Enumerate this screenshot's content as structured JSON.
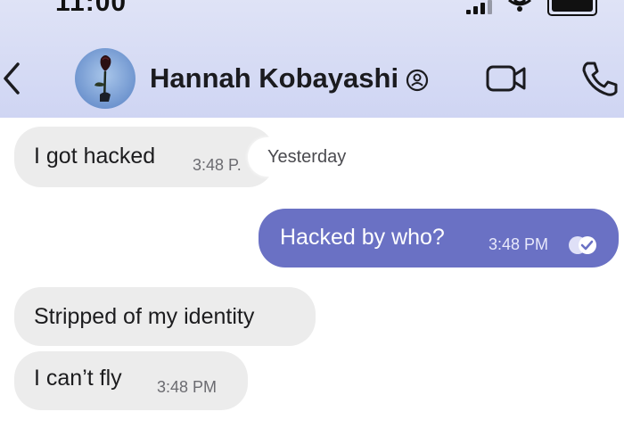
{
  "status_bar": {
    "time": "11:00"
  },
  "header": {
    "contact_name": "Hannah Kobayashi",
    "icons": [
      "back-icon",
      "avatar-rose-image",
      "verified-icon",
      "video-call-icon",
      "phone-call-icon"
    ]
  },
  "date_separator": "Yesterday",
  "messages": [
    {
      "direction": "incoming",
      "text": "I got hacked",
      "time": "3:48 P."
    },
    {
      "direction": "outgoing",
      "text": "Hacked by who?",
      "time": "3:48 PM",
      "status": "read"
    },
    {
      "direction": "incoming",
      "text": "Stripped of my identity",
      "time": ""
    },
    {
      "direction": "incoming",
      "text": "I can’t fly",
      "time": "3:48 PM"
    }
  ],
  "colors": {
    "header_bg": "#d4d9f4",
    "outgoing_bubble": "#6a71c4",
    "incoming_bubble": "#ececec"
  }
}
